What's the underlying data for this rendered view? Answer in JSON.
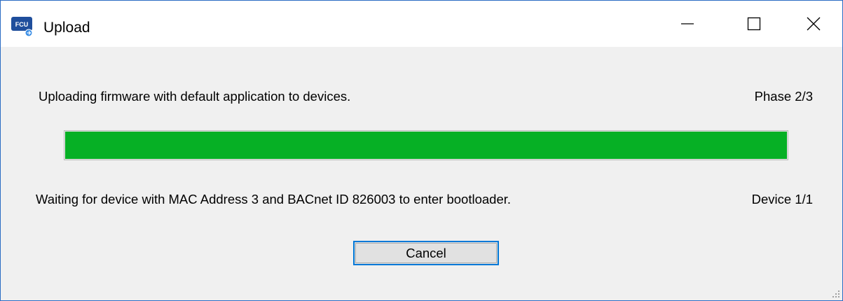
{
  "window": {
    "title": "Upload",
    "app_icon": "fcu-app-icon",
    "app_icon_text": "FCU",
    "controls": {
      "minimize_icon": "minimize-icon",
      "maximize_icon": "maximize-icon",
      "close_icon": "close-icon"
    }
  },
  "upload": {
    "message": "Uploading firmware with default application to devices.",
    "phase": "Phase 2/3",
    "progress": 1.0,
    "progress_color": "#06b025",
    "device_message": "Waiting for device with MAC Address 3 and BACnet ID 826003 to enter bootloader.",
    "device_counter": "Device 1/1",
    "cancel_label": "Cancel"
  },
  "colors": {
    "accent": "#0078d7",
    "window_border": "#2b6cc4",
    "background": "#f0f0f0"
  }
}
